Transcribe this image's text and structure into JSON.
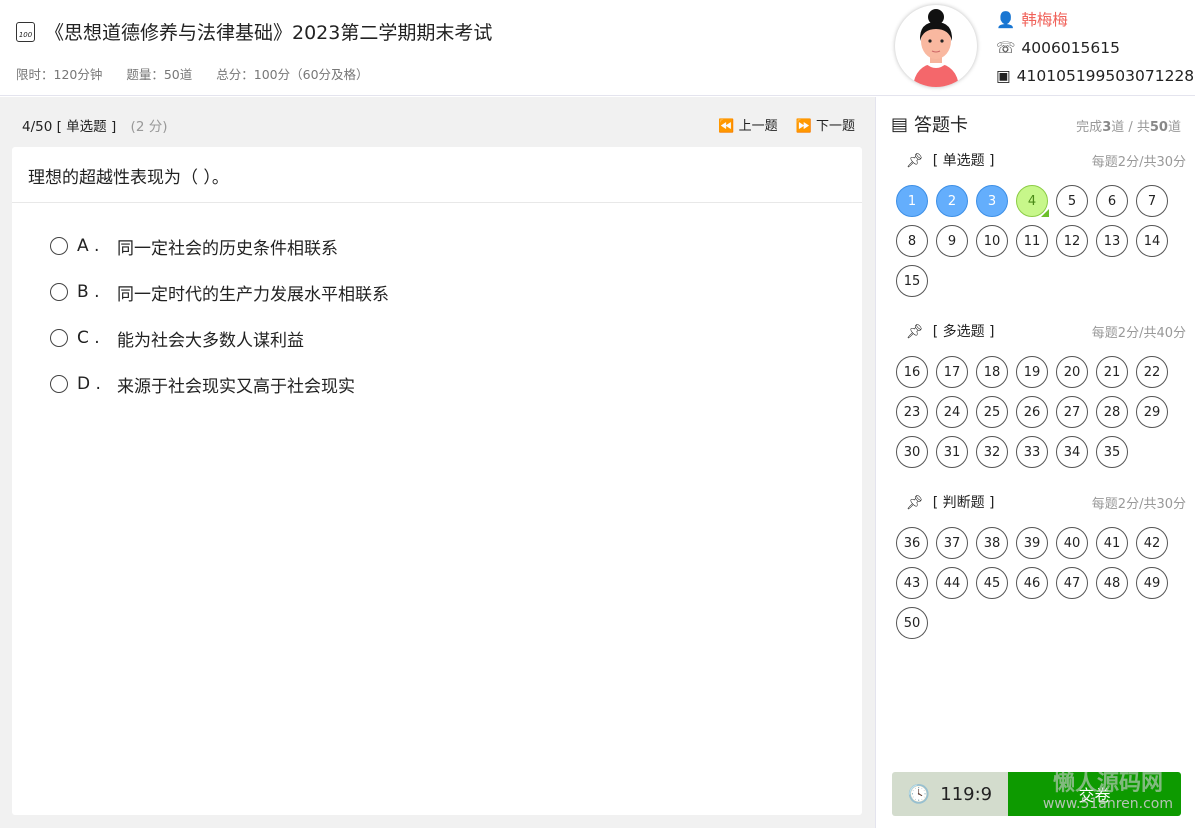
{
  "exam": {
    "title": "《思想道德修养与法律基础》2023第二学期期末考试",
    "icon_text": "100",
    "time_limit": "限时：120分钟",
    "question_count": "题量：50道",
    "total_score": "总分：100分（60分及格）"
  },
  "user": {
    "name": "韩梅梅",
    "phone": "4006015615",
    "id_number": "410105199503071228"
  },
  "question": {
    "progress": "4/50",
    "type": "[ 单选题 ]",
    "points": "(2 分)",
    "prev_label": "上一题",
    "next_label": "下一题",
    "stem": "理想的超越性表现为（ ）。",
    "options": [
      {
        "key": "A .",
        "text": "同一定社会的历史条件相联系"
      },
      {
        "key": "B .",
        "text": "同一定时代的生产力发展水平相联系"
      },
      {
        "key": "C .",
        "text": "能为社会大多数人谋利益"
      },
      {
        "key": "D .",
        "text": "来源于社会现实又高于社会现实"
      }
    ]
  },
  "answer_card": {
    "title": "答题卡",
    "done_prefix": "完成",
    "done": "3",
    "done_mid": "道 / 共",
    "total": "50",
    "done_suffix": "道",
    "sections": [
      {
        "label": "[ 单选题 ]",
        "sub": "每题2分/共30分",
        "start": 1,
        "end": 15
      },
      {
        "label": "[ 多选题 ]",
        "sub": "每题2分/共40分",
        "start": 16,
        "end": 35
      },
      {
        "label": "[ 判断题 ]",
        "sub": "每题2分/共30分",
        "start": 36,
        "end": 50
      }
    ],
    "answered": [
      1,
      2,
      3
    ],
    "current": 4
  },
  "footer": {
    "timer": "119:9",
    "submit_label": "交卷"
  },
  "watermark": {
    "line1": "懒人源码网",
    "line2": "www.51anren.com"
  },
  "colors": {
    "answered": "#64aefc",
    "current": "#c7f78a",
    "submit": "#0d9a00",
    "name": "#f0625a"
  }
}
